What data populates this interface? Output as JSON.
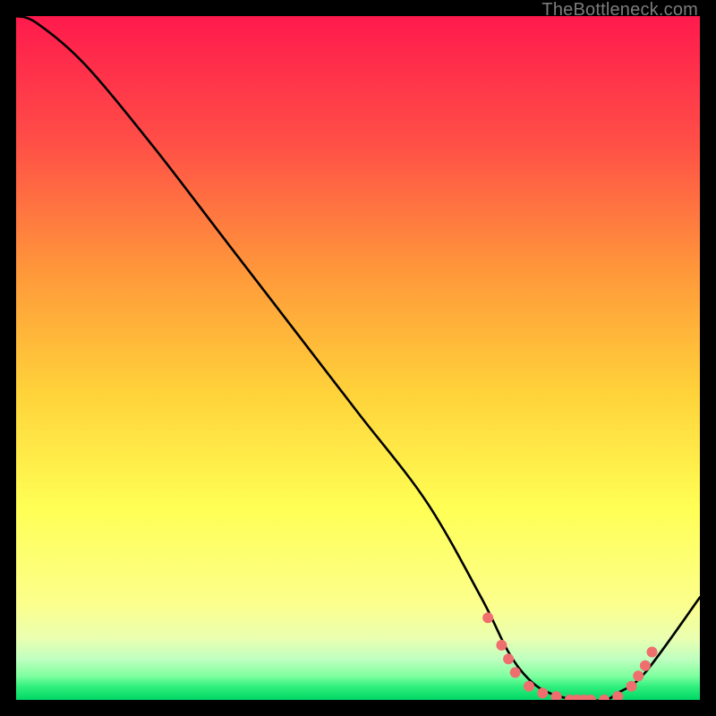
{
  "attribution": "TheBottleneck.com",
  "colors": {
    "bg": "#000000",
    "grad_top": "#ff1a4d",
    "grad_mid_upper": "#ff7a3a",
    "grad_mid": "#ffd23a",
    "grad_mid_lower": "#ffff66",
    "grad_lower_yellow": "#f8ff8a",
    "grad_green_light": "#b6ffb6",
    "grad_green": "#00e66b",
    "line": "#000000",
    "marker": "#ef6f6f"
  },
  "chart_data": {
    "type": "line",
    "title": "",
    "xlabel": "",
    "ylabel": "",
    "xlim": [
      0,
      100
    ],
    "ylim": [
      0,
      100
    ],
    "series": [
      {
        "name": "bottleneck-curve",
        "x": [
          0,
          3,
          10,
          20,
          30,
          40,
          50,
          60,
          68,
          72,
          75,
          78,
          82,
          86,
          88,
          92,
          100
        ],
        "y": [
          100,
          99,
          93,
          81,
          68,
          55,
          42,
          29,
          15,
          7,
          3,
          1,
          0,
          0,
          1,
          4,
          15
        ]
      }
    ],
    "markers": {
      "name": "highlight-points",
      "x": [
        69,
        71,
        72,
        73,
        75,
        77,
        79,
        81,
        82,
        83,
        84,
        86,
        88,
        90,
        91,
        92,
        93
      ],
      "y": [
        12,
        8,
        6,
        4,
        2,
        1,
        0.5,
        0,
        0,
        0,
        0,
        0,
        0.5,
        2,
        3.5,
        5,
        7
      ]
    }
  }
}
